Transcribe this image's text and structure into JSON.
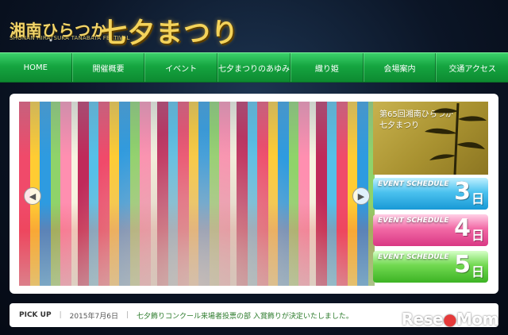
{
  "header": {
    "logo_main": "湘南ひらつか",
    "logo_sub": "SHONAN HIRATSUKA TANABATA FESTIVAL",
    "logo_festival": "七夕まつり"
  },
  "nav": {
    "items": [
      {
        "label": "HOME"
      },
      {
        "label": "開催概要"
      },
      {
        "label": "イベント"
      },
      {
        "label": "七夕まつりのあゆみ"
      },
      {
        "label": "織り姫"
      },
      {
        "label": "会場案内"
      },
      {
        "label": "交通アクセス"
      }
    ]
  },
  "feature": {
    "line1": "第65回湘南ひらつか",
    "line2": "七夕まつり"
  },
  "schedule": [
    {
      "label": "EVENT SCHEDULE",
      "day": "3",
      "unit": "日"
    },
    {
      "label": "EVENT SCHEDULE",
      "day": "4",
      "unit": "日"
    },
    {
      "label": "EVENT SCHEDULE",
      "day": "5",
      "unit": "日"
    }
  ],
  "slider": {
    "prev_icon": "chevron-left-icon",
    "next_icon": "chevron-right-icon"
  },
  "pickup": {
    "label": "PICK UP",
    "separator": "|",
    "date": "2015年7月6日",
    "text": "七夕飾りコンクール来場者投票の部 入賞飾りが決定いたしました。"
  },
  "watermark": {
    "text_a": "Rese",
    "text_b": "Mom"
  }
}
